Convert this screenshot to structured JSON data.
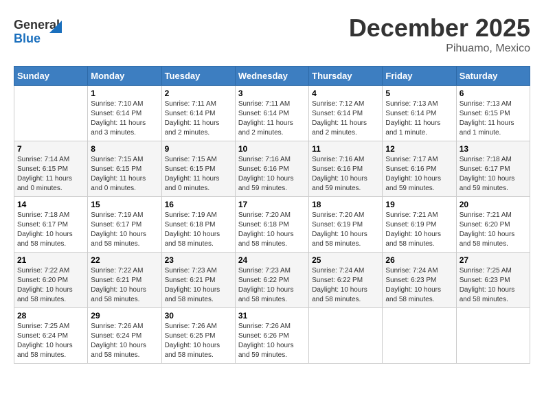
{
  "header": {
    "logo_line1": "General",
    "logo_line2": "Blue",
    "title": "December 2025",
    "subtitle": "Pihuamo, Mexico"
  },
  "calendar": {
    "weekdays": [
      "Sunday",
      "Monday",
      "Tuesday",
      "Wednesday",
      "Thursday",
      "Friday",
      "Saturday"
    ],
    "weeks": [
      [
        {
          "day": "",
          "info": ""
        },
        {
          "day": "1",
          "info": "Sunrise: 7:10 AM\nSunset: 6:14 PM\nDaylight: 11 hours\nand 3 minutes."
        },
        {
          "day": "2",
          "info": "Sunrise: 7:11 AM\nSunset: 6:14 PM\nDaylight: 11 hours\nand 2 minutes."
        },
        {
          "day": "3",
          "info": "Sunrise: 7:11 AM\nSunset: 6:14 PM\nDaylight: 11 hours\nand 2 minutes."
        },
        {
          "day": "4",
          "info": "Sunrise: 7:12 AM\nSunset: 6:14 PM\nDaylight: 11 hours\nand 2 minutes."
        },
        {
          "day": "5",
          "info": "Sunrise: 7:13 AM\nSunset: 6:14 PM\nDaylight: 11 hours\nand 1 minute."
        },
        {
          "day": "6",
          "info": "Sunrise: 7:13 AM\nSunset: 6:15 PM\nDaylight: 11 hours\nand 1 minute."
        }
      ],
      [
        {
          "day": "7",
          "info": "Sunrise: 7:14 AM\nSunset: 6:15 PM\nDaylight: 11 hours\nand 0 minutes."
        },
        {
          "day": "8",
          "info": "Sunrise: 7:15 AM\nSunset: 6:15 PM\nDaylight: 11 hours\nand 0 minutes."
        },
        {
          "day": "9",
          "info": "Sunrise: 7:15 AM\nSunset: 6:15 PM\nDaylight: 11 hours\nand 0 minutes."
        },
        {
          "day": "10",
          "info": "Sunrise: 7:16 AM\nSunset: 6:16 PM\nDaylight: 10 hours\nand 59 minutes."
        },
        {
          "day": "11",
          "info": "Sunrise: 7:16 AM\nSunset: 6:16 PM\nDaylight: 10 hours\nand 59 minutes."
        },
        {
          "day": "12",
          "info": "Sunrise: 7:17 AM\nSunset: 6:16 PM\nDaylight: 10 hours\nand 59 minutes."
        },
        {
          "day": "13",
          "info": "Sunrise: 7:18 AM\nSunset: 6:17 PM\nDaylight: 10 hours\nand 59 minutes."
        }
      ],
      [
        {
          "day": "14",
          "info": "Sunrise: 7:18 AM\nSunset: 6:17 PM\nDaylight: 10 hours\nand 58 minutes."
        },
        {
          "day": "15",
          "info": "Sunrise: 7:19 AM\nSunset: 6:17 PM\nDaylight: 10 hours\nand 58 minutes."
        },
        {
          "day": "16",
          "info": "Sunrise: 7:19 AM\nSunset: 6:18 PM\nDaylight: 10 hours\nand 58 minutes."
        },
        {
          "day": "17",
          "info": "Sunrise: 7:20 AM\nSunset: 6:18 PM\nDaylight: 10 hours\nand 58 minutes."
        },
        {
          "day": "18",
          "info": "Sunrise: 7:20 AM\nSunset: 6:19 PM\nDaylight: 10 hours\nand 58 minutes."
        },
        {
          "day": "19",
          "info": "Sunrise: 7:21 AM\nSunset: 6:19 PM\nDaylight: 10 hours\nand 58 minutes."
        },
        {
          "day": "20",
          "info": "Sunrise: 7:21 AM\nSunset: 6:20 PM\nDaylight: 10 hours\nand 58 minutes."
        }
      ],
      [
        {
          "day": "21",
          "info": "Sunrise: 7:22 AM\nSunset: 6:20 PM\nDaylight: 10 hours\nand 58 minutes."
        },
        {
          "day": "22",
          "info": "Sunrise: 7:22 AM\nSunset: 6:21 PM\nDaylight: 10 hours\nand 58 minutes."
        },
        {
          "day": "23",
          "info": "Sunrise: 7:23 AM\nSunset: 6:21 PM\nDaylight: 10 hours\nand 58 minutes."
        },
        {
          "day": "24",
          "info": "Sunrise: 7:23 AM\nSunset: 6:22 PM\nDaylight: 10 hours\nand 58 minutes."
        },
        {
          "day": "25",
          "info": "Sunrise: 7:24 AM\nSunset: 6:22 PM\nDaylight: 10 hours\nand 58 minutes."
        },
        {
          "day": "26",
          "info": "Sunrise: 7:24 AM\nSunset: 6:23 PM\nDaylight: 10 hours\nand 58 minutes."
        },
        {
          "day": "27",
          "info": "Sunrise: 7:25 AM\nSunset: 6:23 PM\nDaylight: 10 hours\nand 58 minutes."
        }
      ],
      [
        {
          "day": "28",
          "info": "Sunrise: 7:25 AM\nSunset: 6:24 PM\nDaylight: 10 hours\nand 58 minutes."
        },
        {
          "day": "29",
          "info": "Sunrise: 7:26 AM\nSunset: 6:24 PM\nDaylight: 10 hours\nand 58 minutes."
        },
        {
          "day": "30",
          "info": "Sunrise: 7:26 AM\nSunset: 6:25 PM\nDaylight: 10 hours\nand 58 minutes."
        },
        {
          "day": "31",
          "info": "Sunrise: 7:26 AM\nSunset: 6:26 PM\nDaylight: 10 hours\nand 59 minutes."
        },
        {
          "day": "",
          "info": ""
        },
        {
          "day": "",
          "info": ""
        },
        {
          "day": "",
          "info": ""
        }
      ]
    ]
  }
}
